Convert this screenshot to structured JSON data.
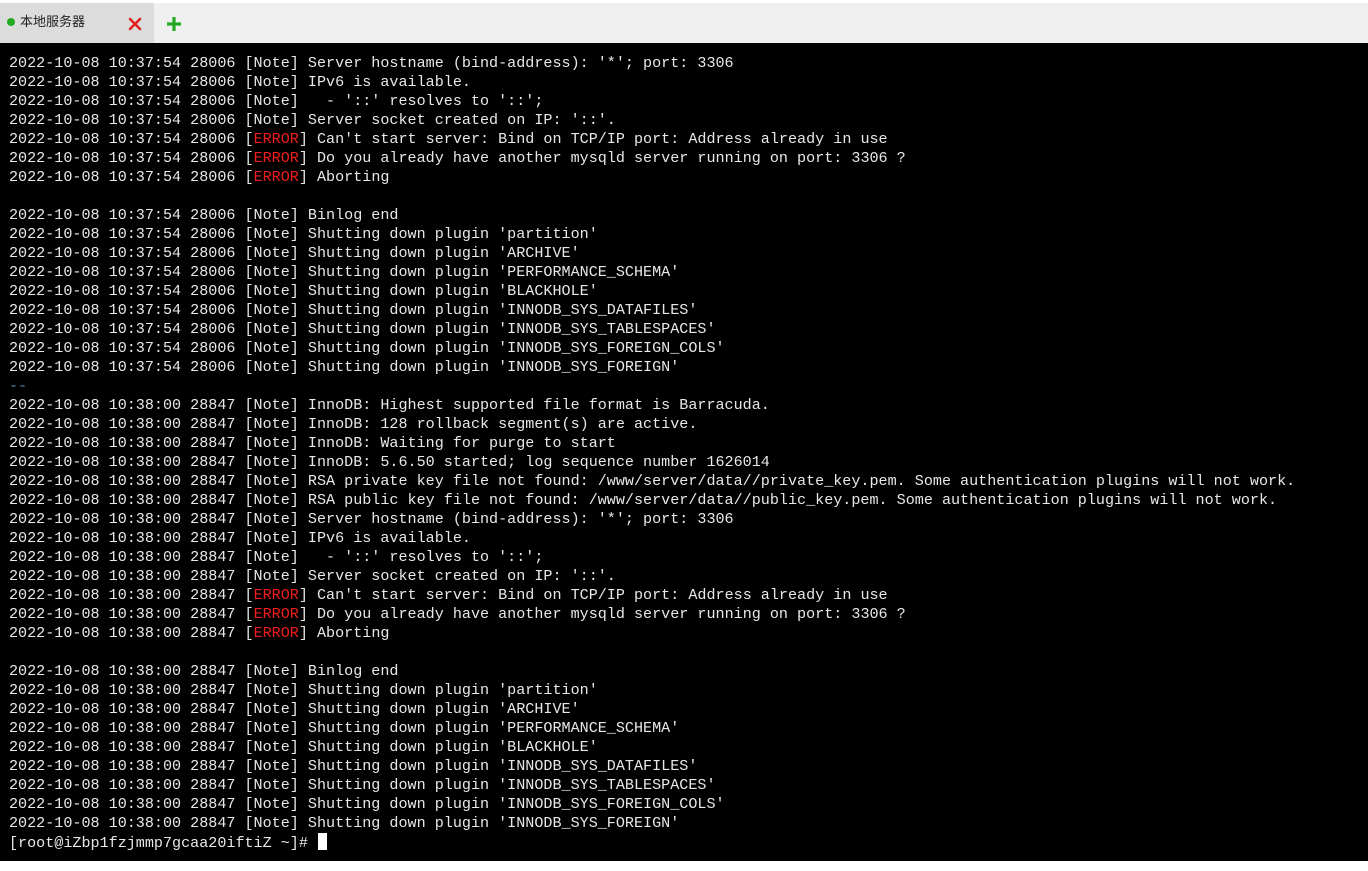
{
  "tabs": [
    {
      "label": "本地服务器",
      "status": "connected",
      "status_color": "#22aa22",
      "icon_close": "close-icon",
      "close_color": "#e02020"
    }
  ],
  "add_tab": {
    "icon": "plus-icon",
    "color": "#22aa22"
  },
  "terminal": {
    "error_color": "#ee1c1c",
    "lines": [
      {
        "text": "2022-10-08 10:37:54 28006 [Note] Server hostname (bind-address): '*'; port: 3306"
      },
      {
        "text": "2022-10-08 10:37:54 28006 [Note] IPv6 is available."
      },
      {
        "text": "2022-10-08 10:37:54 28006 [Note]   - '::' resolves to '::';"
      },
      {
        "text": "2022-10-08 10:37:54 28006 [Note] Server socket created on IP: '::'."
      },
      {
        "prefix": "2022-10-08 10:37:54 28006 [",
        "error": "ERROR",
        "suffix": "] Can't start server: Bind on TCP/IP port: Address already in use"
      },
      {
        "prefix": "2022-10-08 10:37:54 28006 [",
        "error": "ERROR",
        "suffix": "] Do you already have another mysqld server running on port: 3306 ?"
      },
      {
        "prefix": "2022-10-08 10:37:54 28006 [",
        "error": "ERROR",
        "suffix": "] Aborting"
      },
      {
        "text": ""
      },
      {
        "text": "2022-10-08 10:37:54 28006 [Note] Binlog end"
      },
      {
        "text": "2022-10-08 10:37:54 28006 [Note] Shutting down plugin 'partition'"
      },
      {
        "text": "2022-10-08 10:37:54 28006 [Note] Shutting down plugin 'ARCHIVE'"
      },
      {
        "text": "2022-10-08 10:37:54 28006 [Note] Shutting down plugin 'PERFORMANCE_SCHEMA'"
      },
      {
        "text": "2022-10-08 10:37:54 28006 [Note] Shutting down plugin 'BLACKHOLE'"
      },
      {
        "text": "2022-10-08 10:37:54 28006 [Note] Shutting down plugin 'INNODB_SYS_DATAFILES'"
      },
      {
        "text": "2022-10-08 10:37:54 28006 [Note] Shutting down plugin 'INNODB_SYS_TABLESPACES'"
      },
      {
        "text": "2022-10-08 10:37:54 28006 [Note] Shutting down plugin 'INNODB_SYS_FOREIGN_COLS'"
      },
      {
        "text": "2022-10-08 10:37:54 28006 [Note] Shutting down plugin 'INNODB_SYS_FOREIGN'"
      },
      {
        "separator": "--"
      },
      {
        "text": "2022-10-08 10:38:00 28847 [Note] InnoDB: Highest supported file format is Barracuda."
      },
      {
        "text": "2022-10-08 10:38:00 28847 [Note] InnoDB: 128 rollback segment(s) are active."
      },
      {
        "text": "2022-10-08 10:38:00 28847 [Note] InnoDB: Waiting for purge to start"
      },
      {
        "text": "2022-10-08 10:38:00 28847 [Note] InnoDB: 5.6.50 started; log sequence number 1626014"
      },
      {
        "text": "2022-10-08 10:38:00 28847 [Note] RSA private key file not found: /www/server/data//private_key.pem. Some authentication plugins will not work."
      },
      {
        "text": "2022-10-08 10:38:00 28847 [Note] RSA public key file not found: /www/server/data//public_key.pem. Some authentication plugins will not work."
      },
      {
        "text": "2022-10-08 10:38:00 28847 [Note] Server hostname (bind-address): '*'; port: 3306"
      },
      {
        "text": "2022-10-08 10:38:00 28847 [Note] IPv6 is available."
      },
      {
        "text": "2022-10-08 10:38:00 28847 [Note]   - '::' resolves to '::';"
      },
      {
        "text": "2022-10-08 10:38:00 28847 [Note] Server socket created on IP: '::'."
      },
      {
        "prefix": "2022-10-08 10:38:00 28847 [",
        "error": "ERROR",
        "suffix": "] Can't start server: Bind on TCP/IP port: Address already in use"
      },
      {
        "prefix": "2022-10-08 10:38:00 28847 [",
        "error": "ERROR",
        "suffix": "] Do you already have another mysqld server running on port: 3306 ?"
      },
      {
        "prefix": "2022-10-08 10:38:00 28847 [",
        "error": "ERROR",
        "suffix": "] Aborting"
      },
      {
        "text": ""
      },
      {
        "text": "2022-10-08 10:38:00 28847 [Note] Binlog end"
      },
      {
        "text": "2022-10-08 10:38:00 28847 [Note] Shutting down plugin 'partition'"
      },
      {
        "text": "2022-10-08 10:38:00 28847 [Note] Shutting down plugin 'ARCHIVE'"
      },
      {
        "text": "2022-10-08 10:38:00 28847 [Note] Shutting down plugin 'PERFORMANCE_SCHEMA'"
      },
      {
        "text": "2022-10-08 10:38:00 28847 [Note] Shutting down plugin 'BLACKHOLE'"
      },
      {
        "text": "2022-10-08 10:38:00 28847 [Note] Shutting down plugin 'INNODB_SYS_DATAFILES'"
      },
      {
        "text": "2022-10-08 10:38:00 28847 [Note] Shutting down plugin 'INNODB_SYS_TABLESPACES'"
      },
      {
        "text": "2022-10-08 10:38:00 28847 [Note] Shutting down plugin 'INNODB_SYS_FOREIGN_COLS'"
      },
      {
        "text": "2022-10-08 10:38:00 28847 [Note] Shutting down plugin 'INNODB_SYS_FOREIGN'"
      }
    ],
    "prompt": "[root@iZbp1fzjmmp7gcaa20iftiZ ~]# "
  }
}
